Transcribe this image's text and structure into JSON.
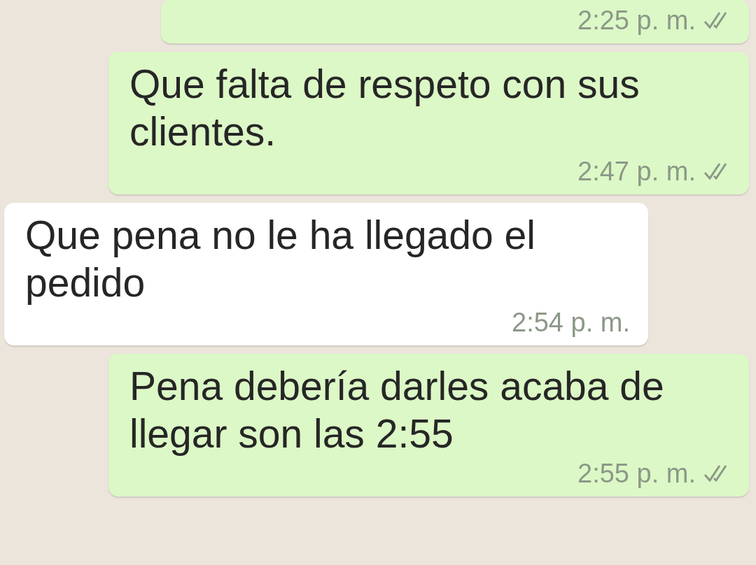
{
  "messages": [
    {
      "outgoing": true,
      "time": "2:25 p. m.",
      "read": false
    },
    {
      "outgoing": true,
      "text": "Que falta de respeto con sus clientes.",
      "time": "2:47 p. m.",
      "read": false
    },
    {
      "outgoing": false,
      "text": "Que pena no le ha llegado el pedido",
      "time": "2:54 p. m."
    },
    {
      "outgoing": true,
      "text": "Pena debería darles acaba de llegar son las 2:55",
      "time": "2:55 p. m.",
      "read": false
    }
  ]
}
